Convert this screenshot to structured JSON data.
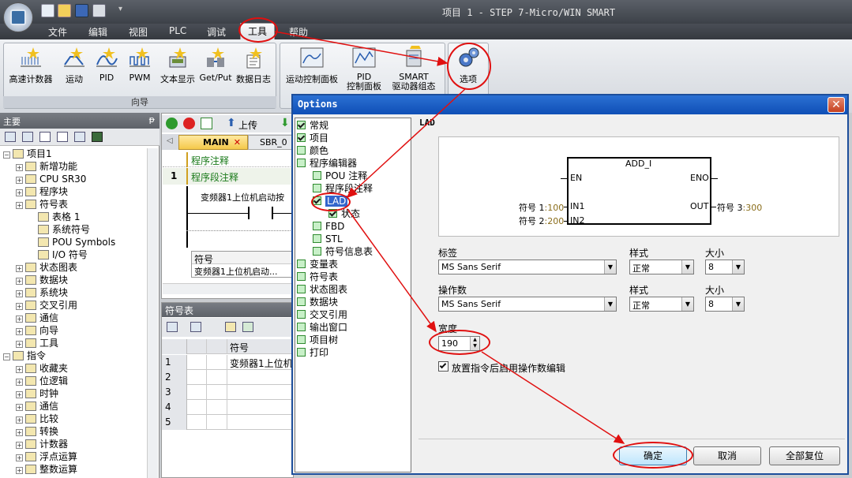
{
  "window": {
    "title": "项目 1 - STEP 7-Micro/WIN SMART"
  },
  "menu": {
    "file": "文件",
    "edit": "编辑",
    "view": "视图",
    "plc": "PLC",
    "debug": "调试",
    "tools": "工具",
    "help": "帮助"
  },
  "ribbon": {
    "wizard_buttons": [
      "高速计数器",
      "运动",
      "PID",
      "PWM",
      "文本显示",
      "Get/Put",
      "数据日志"
    ],
    "motion_panel": "运动控制面板",
    "pid_panel_line1": "PID",
    "pid_panel_line2": "控制面板",
    "smart_line1": "SMART",
    "smart_line2": "驱动器组态",
    "options": "选项",
    "group_wizard": "向导"
  },
  "left_panel": {
    "header": "主要",
    "pin": "ᵽ",
    "tree": [
      {
        "label": "项目1",
        "level": 0
      },
      {
        "label": "新增功能",
        "level": 1
      },
      {
        "label": "CPU SR30",
        "level": 1
      },
      {
        "label": "程序块",
        "level": 1
      },
      {
        "label": "符号表",
        "level": 1
      },
      {
        "label": "表格 1",
        "level": 2
      },
      {
        "label": "系统符号",
        "level": 2
      },
      {
        "label": "POU Symbols",
        "level": 2
      },
      {
        "label": "I/O 符号",
        "level": 2
      },
      {
        "label": "状态图表",
        "level": 1
      },
      {
        "label": "数据块",
        "level": 1
      },
      {
        "label": "系统块",
        "level": 1
      },
      {
        "label": "交叉引用",
        "level": 1
      },
      {
        "label": "通信",
        "level": 1
      },
      {
        "label": "向导",
        "level": 1
      },
      {
        "label": "工具",
        "level": 1
      },
      {
        "label": "指令",
        "level": 0
      },
      {
        "label": "收藏夹",
        "level": 1
      },
      {
        "label": "位逻辑",
        "level": 1
      },
      {
        "label": "时钟",
        "level": 1
      },
      {
        "label": "通信",
        "level": 1
      },
      {
        "label": "比较",
        "level": 1
      },
      {
        "label": "转换",
        "level": 1
      },
      {
        "label": "计数器",
        "level": 1
      },
      {
        "label": "浮点运算",
        "level": 1
      },
      {
        "label": "整数运算",
        "level": 1
      }
    ]
  },
  "editor": {
    "upload": "上传",
    "tab_main": "MAIN",
    "tab_sbr": "SBR_0",
    "program_comment": "程序注释",
    "network_no": "1",
    "network_comment": "程序段注释",
    "rung_comment": "变频器1上位机启动按",
    "sym_col": "符号",
    "sym_val": "变频器1上位机启动..."
  },
  "symbol_table": {
    "header": "符号表",
    "col_symbol": "符号",
    "rows": [
      {
        "no": "1",
        "symbol": "变频器1上位机"
      },
      {
        "no": "2",
        "symbol": ""
      },
      {
        "no": "3",
        "symbol": ""
      },
      {
        "no": "4",
        "symbol": ""
      },
      {
        "no": "5",
        "symbol": ""
      }
    ]
  },
  "dialog": {
    "title": "Options",
    "close": "✕",
    "tree": [
      {
        "label": "常规",
        "checked": true,
        "level": 0
      },
      {
        "label": "项目",
        "checked": true,
        "level": 0
      },
      {
        "label": "颜色",
        "checked": false,
        "level": 0
      },
      {
        "label": "程序编辑器",
        "checked": false,
        "level": 0
      },
      {
        "label": "POU 注释",
        "checked": false,
        "level": 1
      },
      {
        "label": "程序段注释",
        "checked": false,
        "level": 1
      },
      {
        "label": "LAD",
        "checked": true,
        "level": 1
      },
      {
        "label": "状态",
        "checked": true,
        "level": 2
      },
      {
        "label": "FBD",
        "checked": false,
        "level": 1
      },
      {
        "label": "STL",
        "checked": false,
        "level": 1
      },
      {
        "label": "符号信息表",
        "checked": false,
        "level": 1
      },
      {
        "label": "变量表",
        "checked": false,
        "level": 0
      },
      {
        "label": "符号表",
        "checked": false,
        "level": 0
      },
      {
        "label": "状态图表",
        "checked": false,
        "level": 0
      },
      {
        "label": "数据块",
        "checked": false,
        "level": 0
      },
      {
        "label": "交叉引用",
        "checked": false,
        "level": 0
      },
      {
        "label": "输出窗口",
        "checked": false,
        "level": 0
      },
      {
        "label": "项目树",
        "checked": false,
        "level": 0
      },
      {
        "label": "打印",
        "checked": false,
        "level": 0
      }
    ],
    "section_title": "LAD",
    "preview": {
      "box_name": "ADD_I",
      "en": "EN",
      "eno": "ENO",
      "in1": "IN1",
      "in2": "IN2",
      "out": "OUT",
      "sym1_name": "符号 1",
      "sym1_val": ":100",
      "sym2_name": "符号 2",
      "sym2_val": ":200",
      "sym3_name": "符号 3",
      "sym3_val": ":300",
      "value_color": "#8a6d1a"
    },
    "label_font": {
      "label": "标签",
      "font": "MS Sans Serif",
      "style_label": "样式",
      "style": "正常",
      "size_label": "大小",
      "size": "8"
    },
    "operand_font": {
      "label": "操作数",
      "font": "MS Sans Serif",
      "style_label": "样式",
      "style": "正常",
      "size_label": "大小",
      "size": "8"
    },
    "width_label": "宽度",
    "width_value": "190",
    "enable_edit_label": "放置指令后启用操作数编辑",
    "enable_edit_checked": true,
    "buttons": {
      "ok": "确定",
      "cancel": "取消",
      "reset_all": "全部复位"
    }
  },
  "annotation_color": "#e01010"
}
